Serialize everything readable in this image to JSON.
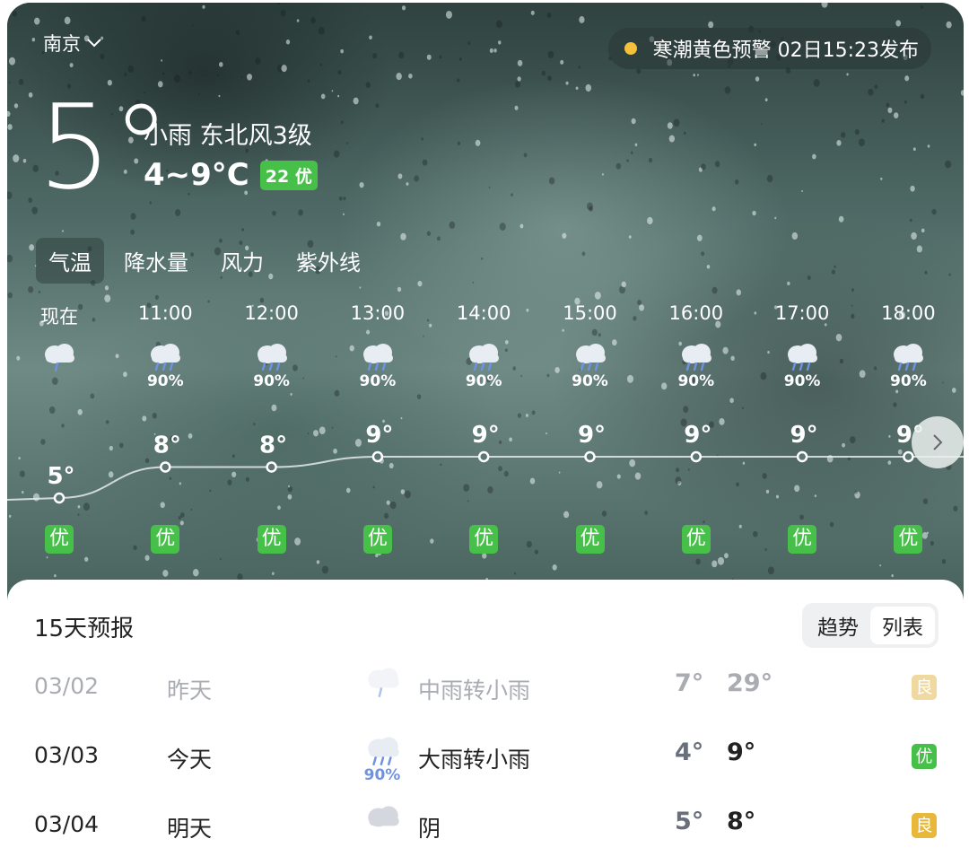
{
  "location": {
    "city": "南京"
  },
  "alert": {
    "text": "寒潮黄色预警 02日15:23发布",
    "dot_color": "#f5c03b"
  },
  "current": {
    "temperature": "5°",
    "condition": "小雨 东北风3级",
    "range": "4~9°C",
    "aqi": "22 优"
  },
  "tabs": [
    "气温",
    "降水量",
    "风力",
    "紫外线"
  ],
  "hourly": [
    {
      "time": "现在",
      "icon": "rain-cloud-icon",
      "precip": "",
      "temp": 5,
      "temp_label": "5°",
      "aqi": "优"
    },
    {
      "time": "11:00",
      "icon": "heavy-rain-cloud-icon",
      "precip": "90%",
      "temp": 8,
      "temp_label": "8°",
      "aqi": "优"
    },
    {
      "time": "12:00",
      "icon": "heavy-rain-cloud-icon",
      "precip": "90%",
      "temp": 8,
      "temp_label": "8°",
      "aqi": "优"
    },
    {
      "time": "13:00",
      "icon": "heavy-rain-cloud-icon",
      "precip": "90%",
      "temp": 9,
      "temp_label": "9°",
      "aqi": "优"
    },
    {
      "time": "14:00",
      "icon": "heavy-rain-cloud-icon",
      "precip": "90%",
      "temp": 9,
      "temp_label": "9°",
      "aqi": "优"
    },
    {
      "time": "15:00",
      "icon": "heavy-rain-cloud-icon",
      "precip": "90%",
      "temp": 9,
      "temp_label": "9°",
      "aqi": "优"
    },
    {
      "time": "16:00",
      "icon": "heavy-rain-cloud-icon",
      "precip": "90%",
      "temp": 9,
      "temp_label": "9°",
      "aqi": "优"
    },
    {
      "time": "17:00",
      "icon": "heavy-rain-cloud-icon",
      "precip": "90%",
      "temp": 9,
      "temp_label": "9°",
      "aqi": "优"
    },
    {
      "time": "18:00",
      "icon": "heavy-rain-cloud-icon",
      "precip": "90%",
      "temp": 9,
      "temp_label": "9°",
      "aqi": "优"
    }
  ],
  "forecast": {
    "title": "15天预报",
    "view_options": [
      "趋势",
      "列表"
    ],
    "active_view": "列表",
    "days": [
      {
        "date": "03/02",
        "day": "昨天",
        "icon": "rain-cloud-icon",
        "precip": "",
        "desc": "中雨转小雨",
        "low": "7°",
        "high": "29°",
        "quality": "良",
        "quality_color": "#f0d9a0",
        "past": true
      },
      {
        "date": "03/03",
        "day": "今天",
        "icon": "heavy-rain-cloud-icon",
        "precip": "90%",
        "desc": "大雨转小雨",
        "low": "4°",
        "high": "9°",
        "quality": "优",
        "quality_color": "#47c04a",
        "past": false
      },
      {
        "date": "03/04",
        "day": "明天",
        "icon": "overcast-cloud-icon",
        "precip": "",
        "desc": "阴",
        "low": "5°",
        "high": "8°",
        "quality": "良",
        "quality_color": "#e7b83a",
        "past": false
      }
    ]
  },
  "colors": {
    "good": "#47c04a",
    "moderate": "#e7b83a"
  }
}
